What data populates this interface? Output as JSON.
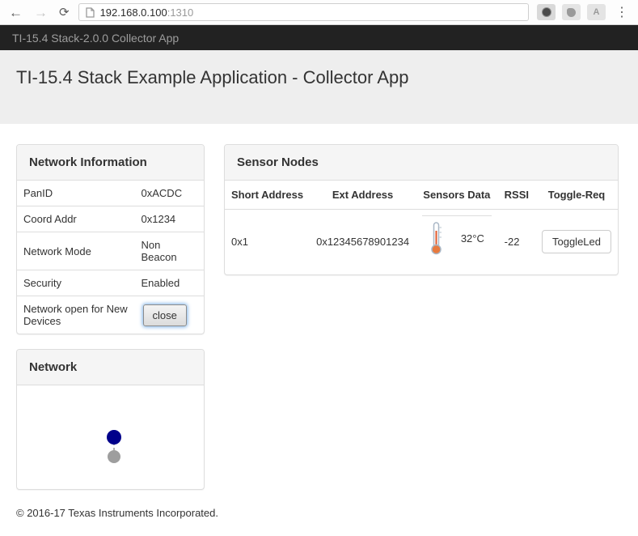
{
  "browser": {
    "url": {
      "host": "192.168.0.100",
      "port": ":1310"
    },
    "back_glyph": "←",
    "forward_glyph": "→",
    "refresh_glyph": "⟳",
    "menu_glyph": "⋮",
    "acrobat_glyph": "A"
  },
  "navbar": {
    "brand": "TI-15.4 Stack-2.0.0 Collector App"
  },
  "header": {
    "title": "TI-15.4 Stack Example Application - Collector App"
  },
  "network_info": {
    "title": "Network Information",
    "rows": [
      {
        "label": "PanID",
        "value": "0xACDC"
      },
      {
        "label": "Coord Addr",
        "value": "0x1234"
      },
      {
        "label": "Network Mode",
        "value": "Non Beacon"
      },
      {
        "label": "Security",
        "value": "Enabled"
      }
    ],
    "open_row_label": "Network open for New Devices",
    "close_button": "close"
  },
  "sensor_nodes": {
    "title": "Sensor Nodes",
    "columns": [
      "Short Address",
      "Ext Address",
      "Sensors Data",
      "RSSI",
      "Toggle-Req"
    ],
    "row": {
      "short_address": "0x1",
      "ext_address": "0x12345678901234",
      "temperature": "32°C",
      "rssi": "-22",
      "toggle_button": "ToggleLed"
    }
  },
  "network_graph": {
    "title": "Network",
    "coordinator_color": "#00008b",
    "device_color": "#9e9e9e",
    "edge_color": "#999999"
  },
  "footer": {
    "copyright": "© 2016-17 Texas Instruments Incorporated."
  }
}
